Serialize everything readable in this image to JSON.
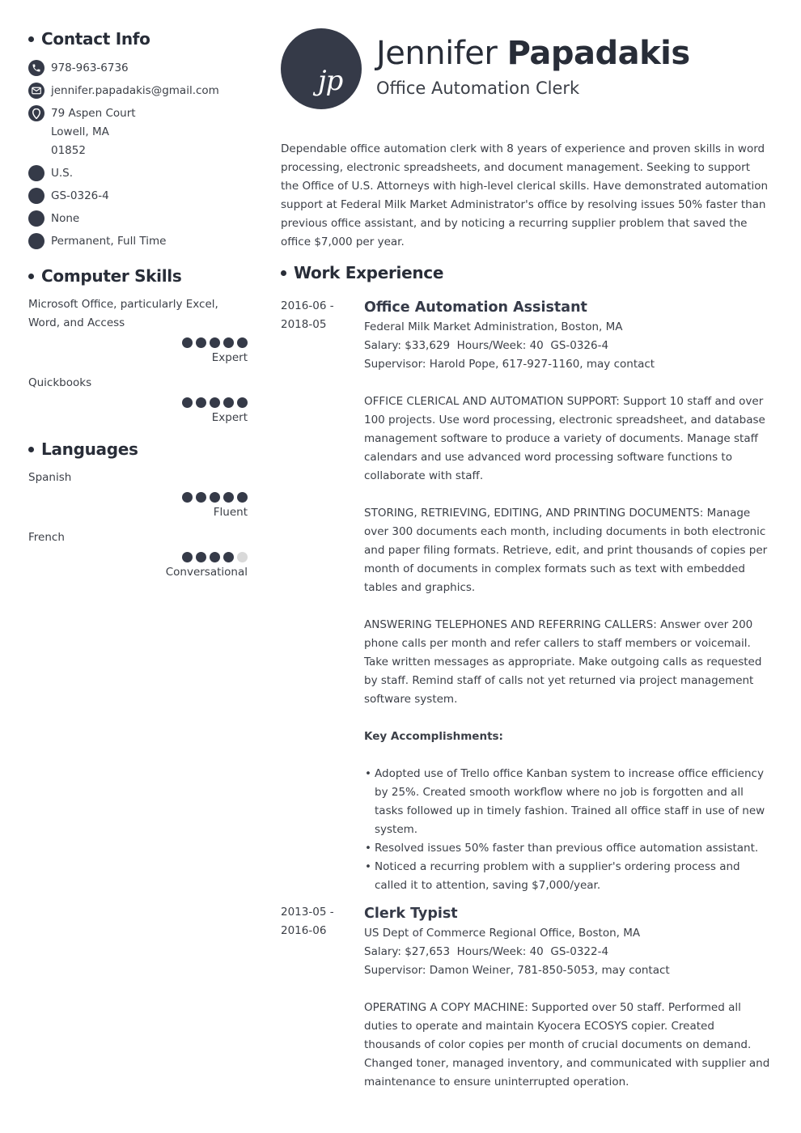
{
  "header": {
    "initials": "jp",
    "first_name": "Jennifer",
    "last_name": "Papadakis",
    "job_title": "Office Automation Clerk"
  },
  "contact": {
    "title": "Contact Info",
    "phone": {
      "icon": "phone-icon",
      "value": "978-963-6736"
    },
    "email": {
      "icon": "envelope-icon",
      "value": "jennifer.papadakis@gmail.com"
    },
    "address": {
      "icon": "location-pin-icon",
      "lines": [
        "79 Aspen Court",
        "Lowell, MA",
        "01852"
      ]
    },
    "extra": [
      {
        "icon": "circle-icon",
        "value": "U.S."
      },
      {
        "icon": "circle-icon",
        "value": "GS-0326-4"
      },
      {
        "icon": "circle-icon",
        "value": "None"
      },
      {
        "icon": "circle-icon",
        "value": "Permanent, Full Time"
      }
    ]
  },
  "computer_skills": {
    "title": "Computer Skills",
    "items": [
      {
        "name": "Microsoft Office, particularly Excel, Word, and Access",
        "rating": 5,
        "max": 5,
        "level": "Expert"
      },
      {
        "name": "Quickbooks",
        "rating": 5,
        "max": 5,
        "level": "Expert"
      }
    ]
  },
  "languages": {
    "title": "Languages",
    "items": [
      {
        "name": "Spanish",
        "rating": 5,
        "max": 5,
        "level": "Fluent"
      },
      {
        "name": "French",
        "rating": 4,
        "max": 5,
        "level": "Conversational"
      }
    ]
  },
  "summary": "Dependable office automation clerk with 8 years of experience and proven skills in word processing, electronic spreadsheets, and document management. Seeking to support the Office of U.S. Attorneys with high-level clerical skills. Have demonstrated automation support at Federal Milk Market Administrator's office by resolving issues 50% faster than previous office assistant, and by noticing a recurring supplier problem that saved the office $7,000 per year.",
  "work_experience": {
    "title": "Work Experience",
    "jobs": [
      {
        "date_start": "2016-06 -",
        "date_end": "2018-05",
        "role": "Office Automation Assistant",
        "employer": "Federal Milk Market Administration, Boston, MA",
        "salary_line": "Salary: $33,629  Hours/Week: 40  GS-0326-4",
        "supervisor": "Supervisor: Harold Pope, 617-927-1160, may contact",
        "paragraphs": [
          "OFFICE CLERICAL AND AUTOMATION SUPPORT: Support 10 staff and over 100 projects. Use word processing, electronic spreadsheet, and database management software to produce a variety of documents. Manage staff calendars and use advanced word processing software functions to collaborate with staff.",
          "STORING, RETRIEVING, EDITING, AND PRINTING DOCUMENTS: Manage over 300 documents each month, including documents in both electronic and paper filing formats. Retrieve, edit, and print thousands of copies per month of documents in complex formats such as text with embedded tables and graphics.",
          "ANSWERING TELEPHONES AND REFERRING CALLERS: Answer over 200 phone calls per month and refer callers to staff members or voicemail. Take written messages as appropriate. Make outgoing calls as requested by staff. Remind staff of calls not yet returned via project management software system."
        ],
        "accomplishments_label": "Key Accomplishments:",
        "accomplishments": [
          "Adopted use of Trello office Kanban system to increase office efficiency by 25%. Created smooth workflow where no job is forgotten and all tasks followed up in timely fashion. Trained all office staff in use of new system.",
          "Resolved issues 50% faster than previous office automation assistant.",
          "Noticed a recurring problem with a supplier's ordering process and called it to attention, saving $7,000/year."
        ]
      },
      {
        "date_start": "2013-05 -",
        "date_end": "2016-06",
        "role": "Clerk Typist",
        "employer": "US Dept of Commerce Regional Office, Boston, MA",
        "salary_line": "Salary: $27,653  Hours/Week: 40  GS-0322-4",
        "supervisor": "Supervisor: Damon Weiner, 781-850-5053, may contact",
        "paragraphs": [
          "OPERATING A COPY MACHINE: Supported over 50 staff. Performed all duties to operate and maintain Kyocera ECOSYS copier. Created thousands of color copies per month of crucial documents on demand. Changed toner, managed inventory, and communicated with supplier and maintenance to ensure uninterrupted operation."
        ]
      }
    ]
  },
  "colors": {
    "accent": "#353a48",
    "heading": "#282d38",
    "text": "#3b3f47",
    "rating_off": "#d9d9d9"
  }
}
